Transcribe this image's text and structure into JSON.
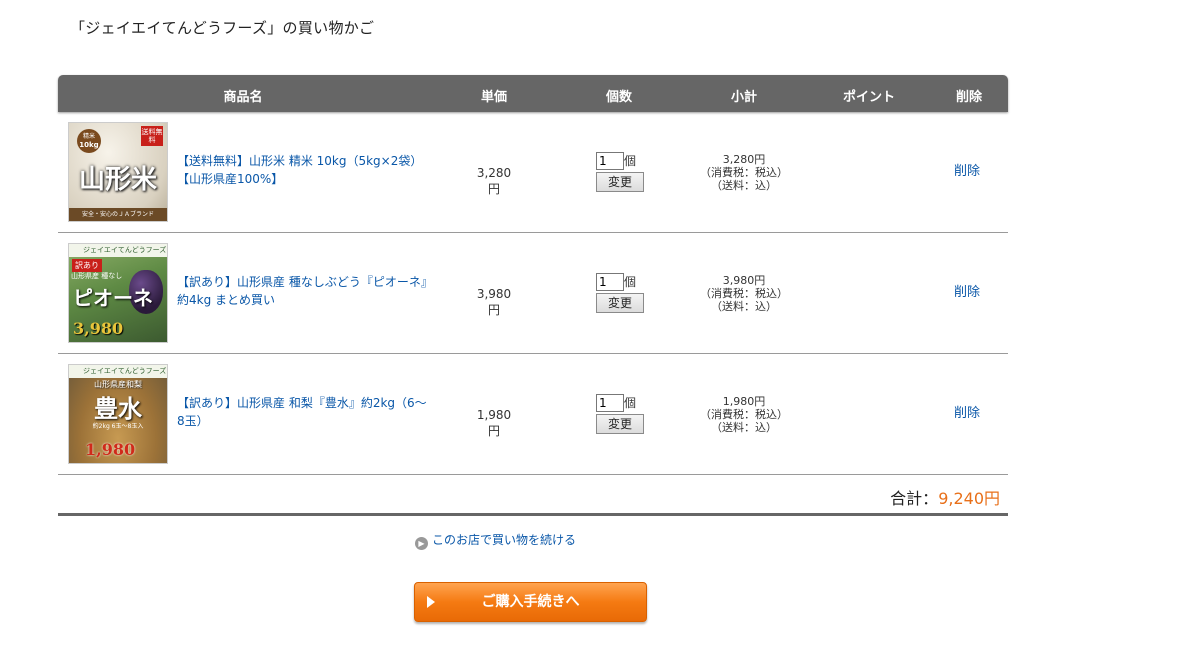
{
  "page": {
    "title": "「ジェイエイてんどうフーズ」の買い物かご"
  },
  "table": {
    "headers": {
      "name": "商品名",
      "price": "単価",
      "qty": "個数",
      "subtotal": "小計",
      "points": "ポイント",
      "delete": "削除"
    },
    "qty_unit": "個",
    "change_label": "変更",
    "delete_label": "削除",
    "items": [
      {
        "name": "【送料無料】山形米 精米 10kg（5kg×2袋）【山形県産100%】",
        "price": "3,280円",
        "qty": "1",
        "subtotal": "3,280円",
        "tax": "（消費税：税込）",
        "shipping": "（送料：込）",
        "thumb": {
          "tag": "精米",
          "weight": "10kg",
          "badge": "送料無料",
          "main": "山形米",
          "footer": "安全・安心のＪＡブランド"
        }
      },
      {
        "name": "【訳あり】山形県産 種なしぶどう『ピオーネ』約4kg まとめ買い",
        "price": "3,980円",
        "qty": "1",
        "subtotal": "3,980円",
        "tax": "（消費税：税込）",
        "shipping": "（送料：込）",
        "thumb": {
          "brand": "ジェイエイてんどうフーズ",
          "badge": "訳あり",
          "sub": "山形県産 種なし",
          "main": "ピオーネ",
          "price": "3,980"
        }
      },
      {
        "name": "【訳あり】山形県産 和梨『豊水』約2kg（6〜8玉）",
        "price": "1,980円",
        "qty": "1",
        "subtotal": "1,980円",
        "tax": "（消費税：税込）",
        "shipping": "（送料：込）",
        "thumb": {
          "brand": "ジェイエイてんどうフーズ",
          "sub": "山形県産和梨",
          "main": "豊水",
          "detail": "約2kg 6玉〜8玉入",
          "price": "1,980"
        }
      }
    ],
    "total_label": "合計：",
    "total_value": "9,240円"
  },
  "links": {
    "continue": "このお店で買い物を続ける"
  },
  "checkout": {
    "label": "ご購入手続きへ"
  },
  "colors": {
    "header_bg": "#666666",
    "link": "#0a57a8",
    "accent": "#e8701a",
    "button_orange": "#f57a12"
  }
}
